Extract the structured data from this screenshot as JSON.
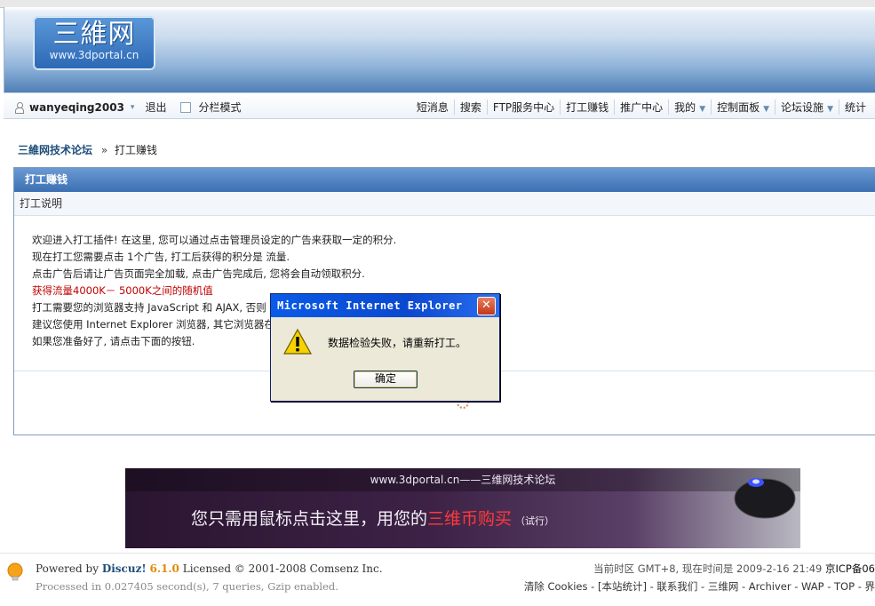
{
  "header": {
    "logo_title": "三維网",
    "logo_url": "www.3dportal.cn"
  },
  "navbar": {
    "username": "wanyeqing2003",
    "logout": "退出",
    "split_mode": "分栏模式",
    "items": [
      "短消息",
      "搜索",
      "FTP服务中心",
      "打工赚钱",
      "推广中心",
      "我的",
      "控制面板",
      "论坛设施",
      "统计"
    ]
  },
  "breadcrumb": {
    "home": "三維网技术论坛",
    "separator": "»",
    "current": "打工赚钱"
  },
  "panel": {
    "title": "打工赚钱",
    "subtitle": "打工说明",
    "lines": [
      "欢迎进入打工插件! 在这里, 您可以通过点击管理员设定的广告来获取一定的积分.",
      "现在打工您需要点击  1个广告, 打工后获得的积分是  流量.",
      "点击广告后请让广告页面完全加载, 点击广告完成后, 您将会自动领取积分.",
      "获得流量4000K－ 5000K之间的随机值",
      "打工需要您的浏览器支持  JavaScript 和  AJAX, 否则",
      "建议您使用  Internet Explorer 浏览器, 其它浏览器在",
      "如果您准备好了, 请点击下面的按钮."
    ]
  },
  "banner": {
    "top_text": "www.3dportal.cn——三维网技术论坛",
    "main_prefix": "您只需用鼠标点击这里，用您的",
    "main_highlight": "三维币购买",
    "main_suffix": "（试行）"
  },
  "footer": {
    "powered_prefix": "Powered by",
    "discuz": "Discuz!",
    "version": "6.1.0",
    "license": "Licensed © 2001-2008 Comsenz Inc.",
    "processed": "Processed in 0.027405 second(s), 7 queries, Gzip enabled.",
    "timezone_text": "当前时区  GMT+8, 现在时间是  2009-2-16 21:49",
    "icp": "京ICP备06",
    "links": "清除  Cookies - [本站统计] - 联系我们  - 三维网  - Archiver - WAP - TOP - 界"
  },
  "dialog": {
    "title": "Microsoft Internet Explorer",
    "message": "数据检验失败，请重新打工。",
    "ok_label": "确定",
    "close_glyph": "✕"
  }
}
